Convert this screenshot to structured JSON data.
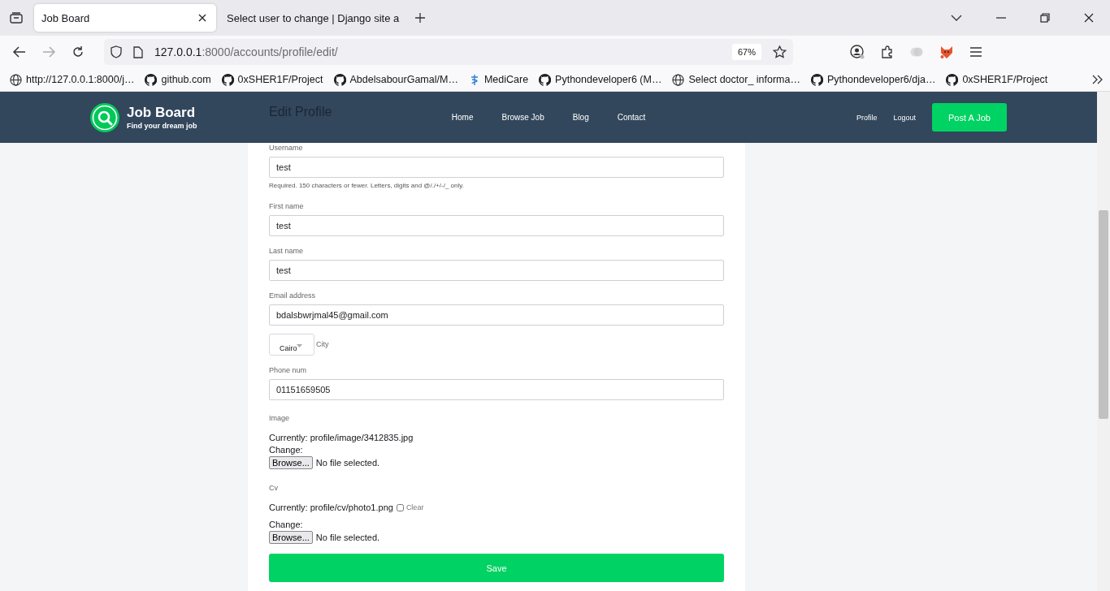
{
  "browser": {
    "tabs": [
      {
        "title": "Job Board",
        "selected": true
      },
      {
        "title": "Select user to change | Django site a",
        "selected": false
      }
    ],
    "url": {
      "host": "127.0.0.1",
      "rest": ":8000/accounts/profile/edit/"
    },
    "zoom": "67%",
    "bookmarks": [
      {
        "label": "http://127.0.0.1:8000/j…",
        "kind": "globe"
      },
      {
        "label": "github.com",
        "kind": "github"
      },
      {
        "label": "0xSHER1F/Project",
        "kind": "github"
      },
      {
        "label": "AbdelsabourGamal/M…",
        "kind": "github"
      },
      {
        "label": "MediCare",
        "kind": "medicare"
      },
      {
        "label": "Pythondeveloper6 (M…",
        "kind": "github"
      },
      {
        "label": "Select doctor_ informa…",
        "kind": "globe"
      },
      {
        "label": "Pythondeveloper6/dja…",
        "kind": "github"
      },
      {
        "label": "0xSHER1F/Project",
        "kind": "github"
      }
    ]
  },
  "site": {
    "brand": {
      "name": "Job Board",
      "tagline": "Find your dream job"
    },
    "nav": [
      "Home",
      "Browse Job",
      "Blog",
      "Contact"
    ],
    "account_links": [
      "Profile",
      "Logout"
    ],
    "post_button": "Post A Job"
  },
  "form": {
    "title": "Edit Profile",
    "fields": [
      {
        "kind": "text",
        "label": "Username",
        "value": "test",
        "help": "Required. 150 characters or fewer. Letters, digits and @/./+/-/_ only."
      },
      {
        "kind": "text",
        "label": "First name",
        "value": "test"
      },
      {
        "kind": "text",
        "label": "Last name",
        "value": "test"
      },
      {
        "kind": "text",
        "label": "Email address",
        "value": "bdalsbwrjmal45@gmail.com"
      },
      {
        "kind": "select",
        "label": "City",
        "value": "Cairo"
      },
      {
        "kind": "text",
        "label": "Phone num",
        "value": "01151659505"
      },
      {
        "kind": "file",
        "label": "Image",
        "current_label": "Currently:",
        "current": "profile/image/3412835.jpg",
        "change_label": "Change:",
        "browse": "Browse...",
        "status": "No file selected."
      },
      {
        "kind": "file",
        "label": "Cv",
        "current_label": "Currently:",
        "current": "profile/cv/photo1.png",
        "clear": {
          "label": "Clear",
          "checked": false
        },
        "change_label": "Change:",
        "browse": "Browse...",
        "status": "No file selected."
      }
    ],
    "save": "Save"
  }
}
